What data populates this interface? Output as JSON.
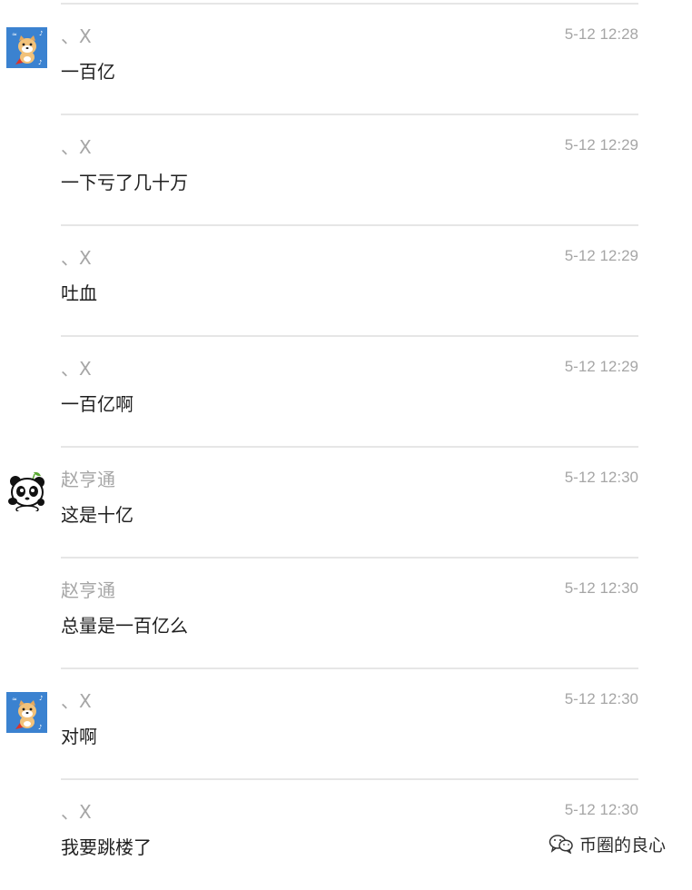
{
  "messages": [
    {
      "sender": "、X",
      "time": "5-12 12:28",
      "text": "一百亿",
      "avatar": "dog-avatar-icon",
      "show_avatar": true
    },
    {
      "sender": "、X",
      "time": "5-12 12:29",
      "text": "一下亏了几十万",
      "avatar": "dog-avatar-icon",
      "show_avatar": false
    },
    {
      "sender": "、X",
      "time": "5-12 12:29",
      "text": "吐血",
      "avatar": "dog-avatar-icon",
      "show_avatar": false
    },
    {
      "sender": "、X",
      "time": "5-12 12:29",
      "text": "一百亿啊",
      "avatar": "dog-avatar-icon",
      "show_avatar": false
    },
    {
      "sender": "赵亨通",
      "time": "5-12 12:30",
      "text": "这是十亿",
      "avatar": "panda-avatar-icon",
      "show_avatar": true
    },
    {
      "sender": "赵亨通",
      "time": "5-12 12:30",
      "text": "总量是一百亿么",
      "avatar": "panda-avatar-icon",
      "show_avatar": false
    },
    {
      "sender": "、X",
      "time": "5-12 12:30",
      "text": "对啊",
      "avatar": "dog-avatar-icon",
      "show_avatar": true
    },
    {
      "sender": "、X",
      "time": "5-12 12:30",
      "text": "我要跳楼了",
      "avatar": "dog-avatar-icon",
      "show_avatar": false
    }
  ],
  "watermark": {
    "icon": "wechat-icon",
    "label": "币圈的良心"
  },
  "colors": {
    "meta_text": "#a6a6a6",
    "message_text": "#1f1f1f",
    "divider": "#e6e6e6",
    "dog_avatar_bg": "#3b82d0"
  }
}
